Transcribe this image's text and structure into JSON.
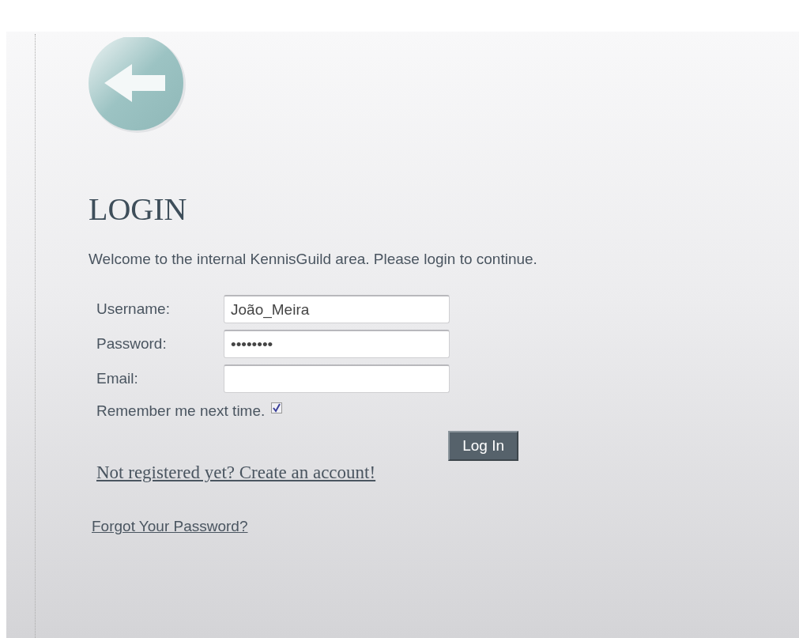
{
  "heading": "LOGIN",
  "intro": "Welcome to the internal KennisGuild area. Please login to continue.",
  "fields": [
    {
      "label": "Username:",
      "value": "João_Meira"
    },
    {
      "label": "Password:",
      "value": "••••••••"
    },
    {
      "label": "Email:"
    }
  ],
  "remember": {
    "label": "Remember me next time.",
    "checked": true
  },
  "login_button": "Log In",
  "register_link": "Not registered yet? Create an account!",
  "forgot_link": "Forgot Your Password?"
}
